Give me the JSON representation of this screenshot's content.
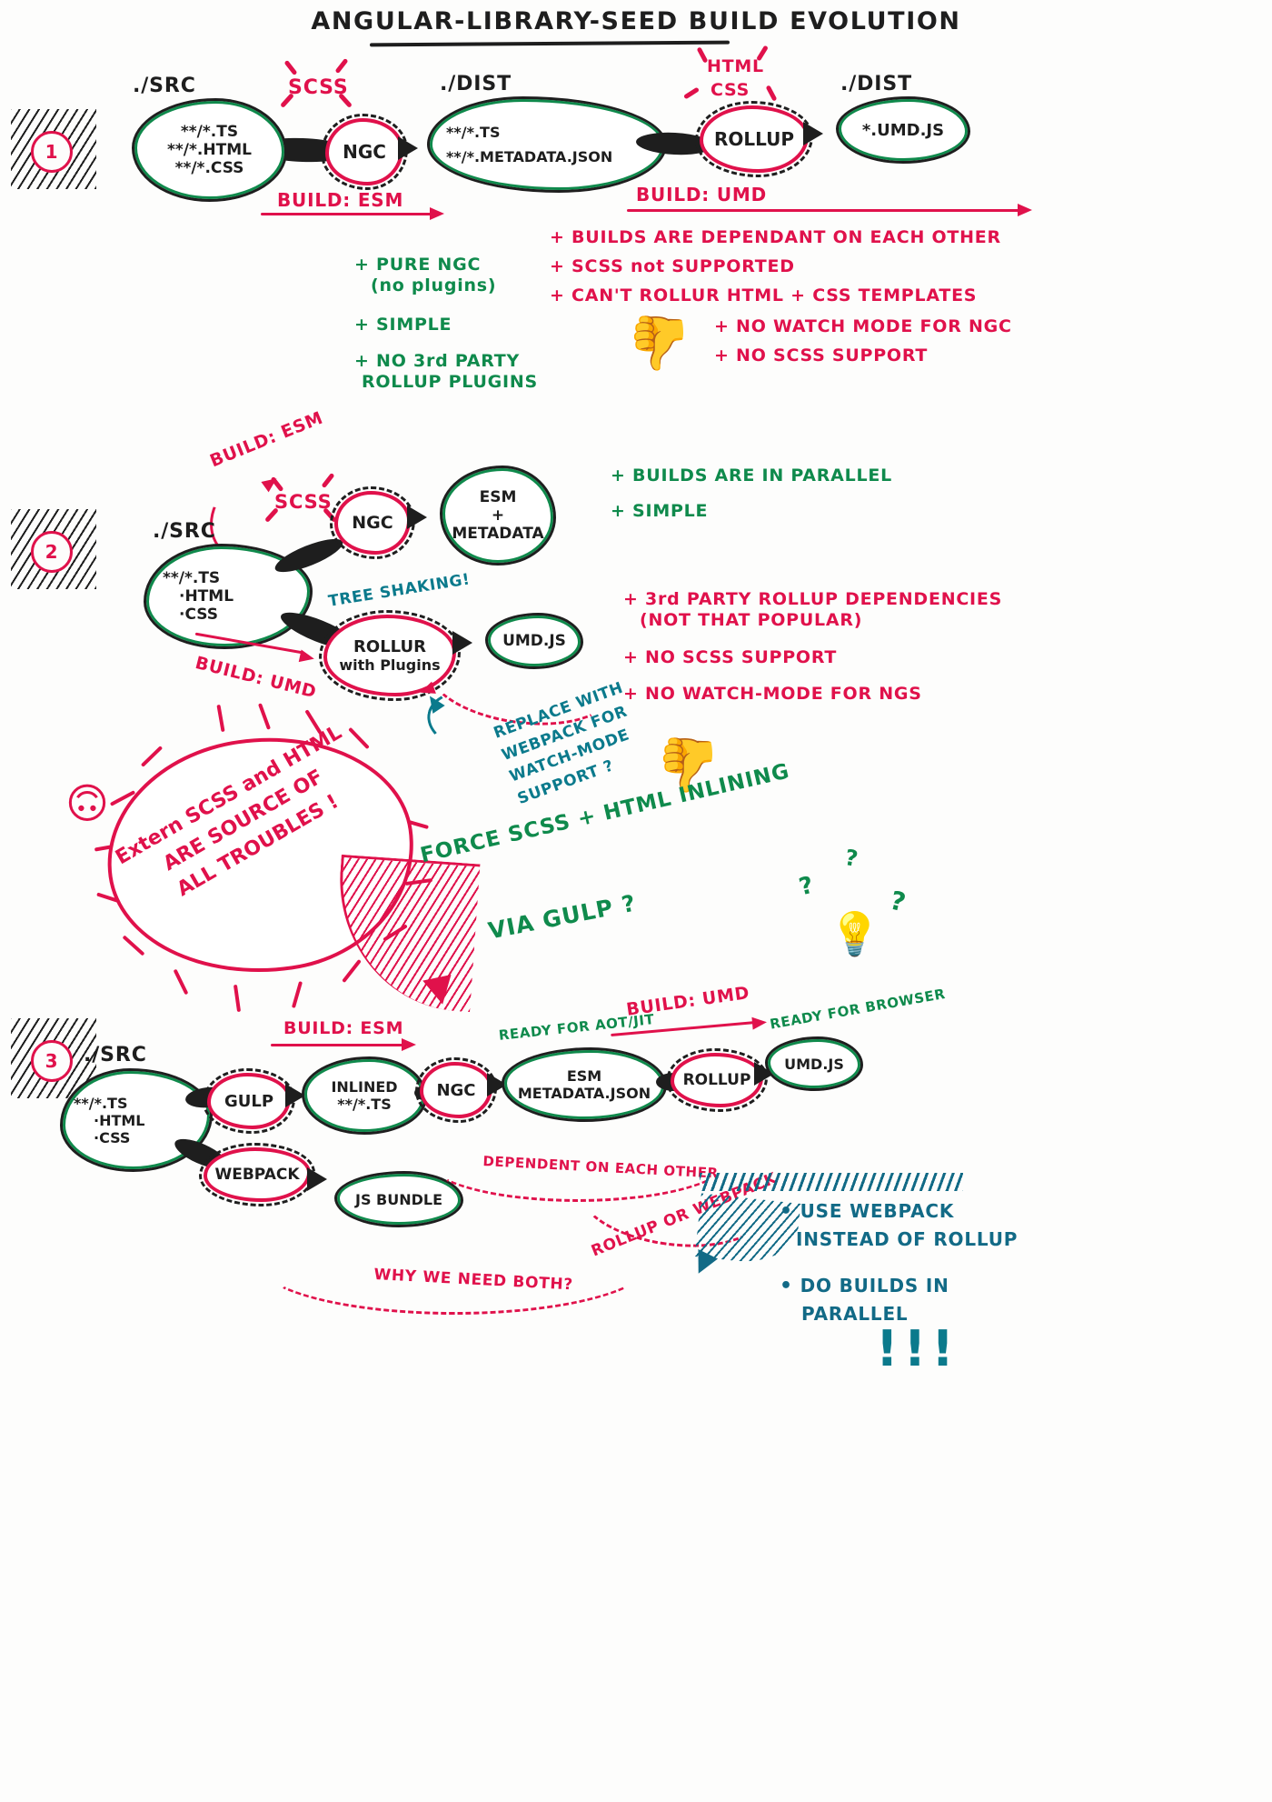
{
  "title": "ANGULAR-LIBRARY-SEED BUILD EVOLUTION",
  "steps": [
    {
      "number": "1",
      "nodes": {
        "src_label": "./SRC",
        "src_lines": [
          "**/*.TS",
          "**/*.HTML",
          "**/*.CSS"
        ],
        "ngc": "NGC",
        "dist_label": "./DIST",
        "dist_lines": [
          "**/*.TS",
          "**/*.METADATA.JSON"
        ],
        "rollup": "ROLLUP",
        "dist2_label": "./DIST",
        "dist2_lines": [
          "*.UMD.JS"
        ]
      },
      "bursts": [
        {
          "text": "SCSS"
        },
        {
          "text_line1": "HTML",
          "text_line2": "CSS"
        }
      ],
      "arrows": [
        {
          "label": "BUILD: ESM"
        },
        {
          "label": "BUILD: UMD"
        }
      ],
      "pros": [
        {
          "text": "+ PURE NGC",
          "sub": "(no plugins)"
        },
        {
          "text": "+ SIMPLE",
          "sub": ""
        },
        {
          "text": "+ NO 3rd PARTY",
          "sub": "ROLLUP PLUGINS"
        }
      ],
      "cons": [
        "+ BUILDS ARE DEPENDANT ON EACH OTHER",
        "+ SCSS not SUPPORTED",
        "+ CAN'T ROLLUR HTML + CSS TEMPLATES"
      ],
      "cons2": [
        "+ NO WATCH MODE FOR NGC",
        "+ NO SCSS SUPPORT"
      ]
    },
    {
      "number": "2",
      "nodes": {
        "src_label": "./SRC",
        "src_lines": [
          "**/*.TS",
          "·HTML",
          "·CSS"
        ],
        "ngc": "NGC",
        "esm_lines": [
          "ESM",
          "+",
          "METADATA"
        ],
        "rollup_lines": [
          "ROLLUR",
          "with Plugins"
        ],
        "umd": "UMD.JS"
      },
      "bursts": [
        {
          "text": "SCSS"
        }
      ],
      "arrows": [
        {
          "label": "BUILD: ESM"
        },
        {
          "label": "BUILD: UMD"
        }
      ],
      "tree_shaking": "TREE SHAKING!",
      "pros": [
        "+ BUILDS ARE IN PARALLEL",
        "+ SIMPLE"
      ],
      "cons": [
        {
          "text": "+ 3rd PARTY ROLLUP DEPENDENCIES",
          "sub": "(NOT THAT POPULAR)"
        },
        {
          "text": "+ NO SCSS SUPPORT",
          "sub": ""
        },
        {
          "text": "+ NO WATCH-MODE FOR NGS",
          "sub": ""
        }
      ],
      "replace_note": [
        "REPLACE WITH",
        "WEBPACK FOR",
        "WATCH-MODE",
        "SUPPORT ?"
      ]
    },
    {
      "number": "3",
      "nodes": {
        "src_label": "./SRC",
        "src_lines": [
          "**/*.TS",
          "·HTML",
          "·CSS"
        ],
        "gulp": "GULP",
        "webpack": "WEBPACK",
        "inlined_lines": [
          "INLINED",
          "**/*.TS"
        ],
        "ngc": "NGC",
        "esm_lines": [
          "ESM",
          "METADATA.JSON"
        ],
        "rollup": "ROLLUP",
        "umd": "UMD.JS",
        "js_bundle": "JS BUNDLE"
      },
      "arrows": [
        {
          "label": "BUILD: ESM"
        },
        {
          "label": "BUILD: UMD"
        }
      ],
      "ready_aot": "READY FOR AOT/JIT",
      "ready_browser": "READY FOR BROWSER",
      "dependent_note": "DEPENDENT ON EACH OTHER",
      "why_both_note": "WHY WE NEED BOTH?",
      "rollup_or_webpack_note": "ROLLUP OR WEBPACK",
      "suggestions": [
        {
          "line1": "USE WEBPACK",
          "line2": "INSTEAD OF ROLLUP"
        },
        {
          "line1": "DO BUILDS IN",
          "line2": "PARALLEL"
        }
      ],
      "exclaim": "!!!"
    }
  ],
  "trouble": {
    "lines": [
      "Extern SCSS and HTML",
      "ARE SOURCE OF",
      "ALL TROUBLES !"
    ]
  },
  "gulp_question": {
    "line1": "FORCE SCSS + HTML INLINING",
    "line2": "VIA GULP ?"
  },
  "question_marks": [
    "?",
    "?",
    "?"
  ],
  "colors": {
    "red": "#e0114b",
    "green": "#0f8a4c",
    "teal": "#0b7a8c",
    "black": "#1e1e1e"
  }
}
